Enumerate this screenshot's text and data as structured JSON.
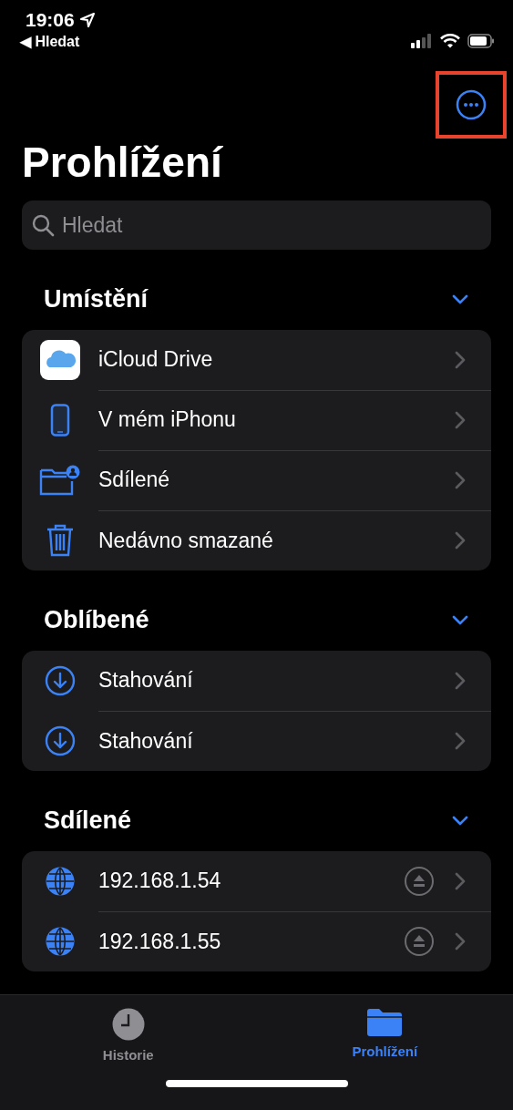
{
  "status_bar": {
    "time": "19:06",
    "back_icon": "◀",
    "back_label": "Hledat"
  },
  "more_button": {
    "highlighted": true
  },
  "title": "Prohlížení",
  "search": {
    "placeholder": "Hledat"
  },
  "sections": [
    {
      "title": "Umístění",
      "expanded": true,
      "items": [
        {
          "kind": "icloud",
          "label": "iCloud Drive",
          "eject": false
        },
        {
          "kind": "phone",
          "label": "V mém iPhonu",
          "eject": false
        },
        {
          "kind": "shared-folder",
          "label": "Sdílené",
          "eject": false
        },
        {
          "kind": "trash",
          "label": "Nedávno smazané",
          "eject": false
        }
      ]
    },
    {
      "title": "Oblíbené",
      "expanded": true,
      "items": [
        {
          "kind": "download",
          "label": "Stahování",
          "eject": false
        },
        {
          "kind": "download",
          "label": "Stahování",
          "eject": false
        }
      ]
    },
    {
      "title": "Sdílené",
      "expanded": true,
      "items": [
        {
          "kind": "globe",
          "label": "192.168.1.54",
          "eject": true
        },
        {
          "kind": "globe",
          "label": "192.168.1.55",
          "eject": true
        }
      ]
    }
  ],
  "tabs": [
    {
      "kind": "clock",
      "label": "Historie",
      "selected": false
    },
    {
      "kind": "folder",
      "label": "Prohlížení",
      "selected": true
    }
  ]
}
